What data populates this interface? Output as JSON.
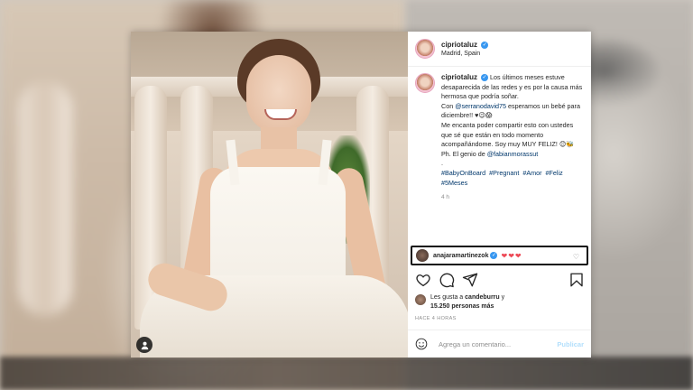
{
  "post": {
    "username": "cipriotaluz",
    "location": "Madrid, Spain",
    "caption": {
      "line1": "Los últimos meses estuve desaparecida de las redes y es por la causa más hermosa que podría soñar.",
      "con": "Con",
      "mention1": "@serranodavid75",
      "line2": "esperamos un bebé para diciembre!! ♥😉😱",
      "line3": "Me encanta poder compartir esto con ustedes que sé que están en todo momento acompañándome. Soy muy MUY FELIZ! 😊🐝",
      "ph": "Ph. El genio de",
      "mention2": "@fabianmorassut",
      "dot": ".",
      "hashtags": [
        "#BabyOnBoard",
        "#Pregnant",
        "#Amor",
        "#Feliz",
        "#5Meses"
      ]
    },
    "time": "4 h",
    "comment": {
      "username": "anajaramartinezok",
      "text": "❤❤❤"
    },
    "likes": {
      "prefix": "Les gusta a",
      "user": "candeburru",
      "conj": "y",
      "count": "15.250 personas más"
    },
    "posted_ago": "HACE 4 HORAS",
    "add_comment_placeholder": "Agrega un comentario...",
    "publish_label": "Publicar"
  },
  "colors": {
    "link": "#00376b",
    "verified": "#3897f0",
    "heart": "#ed4956",
    "publish_disabled": "#b2dffc"
  },
  "icons": [
    "verified-badge-icon",
    "heart-icon",
    "comment-icon",
    "share-icon",
    "save-icon",
    "emoji-icon",
    "tag-person-icon"
  ]
}
